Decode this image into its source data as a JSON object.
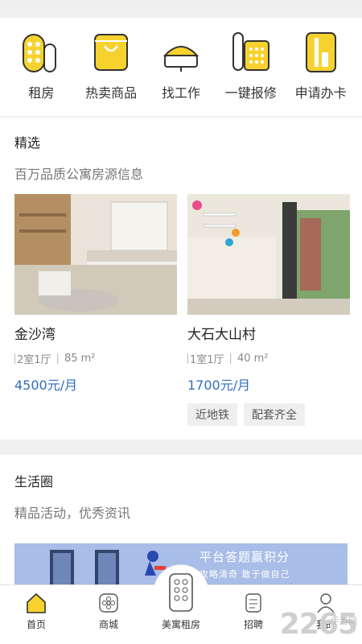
{
  "quick_actions": [
    {
      "label": "租房",
      "icon": "rent-icon"
    },
    {
      "label": "热卖商品",
      "icon": "shopping-bag-icon"
    },
    {
      "label": "找工作",
      "icon": "job-icon"
    },
    {
      "label": "一键报修",
      "icon": "repair-icon"
    },
    {
      "label": "申请办卡",
      "icon": "card-icon"
    }
  ],
  "featured": {
    "title": "精选",
    "subtitle": "百万品质公寓房源信息",
    "listings": [
      {
        "name": "金沙湾",
        "layout": "2室1厅",
        "area": "85 m²",
        "price": "4500元/月"
      },
      {
        "name": "大石大山村",
        "layout": "1室1厅",
        "area": "40 m²",
        "price": "1700元/月"
      }
    ],
    "tags": [
      "近地铁",
      "配套齐全"
    ]
  },
  "life": {
    "title": "生活圈",
    "subtitle": "精品活动，优秀资讯",
    "banner_title": "平台答题赢积分",
    "banner_sub": "攻略清奇 敢于做自己"
  },
  "tabs": [
    {
      "label": "首页",
      "icon": "home-icon",
      "active": true
    },
    {
      "label": "商城",
      "icon": "mall-icon"
    },
    {
      "label": "美寓租房",
      "icon": "remote-icon"
    },
    {
      "label": "招聘",
      "icon": "recruit-icon"
    },
    {
      "label": "我的",
      "icon": "profile-icon"
    }
  ],
  "watermark": {
    "big": "2265",
    "small": "手游网"
  },
  "colors": {
    "accent": "#f7d22e",
    "price": "#2f6fbd",
    "banner": "#a8bde7"
  }
}
